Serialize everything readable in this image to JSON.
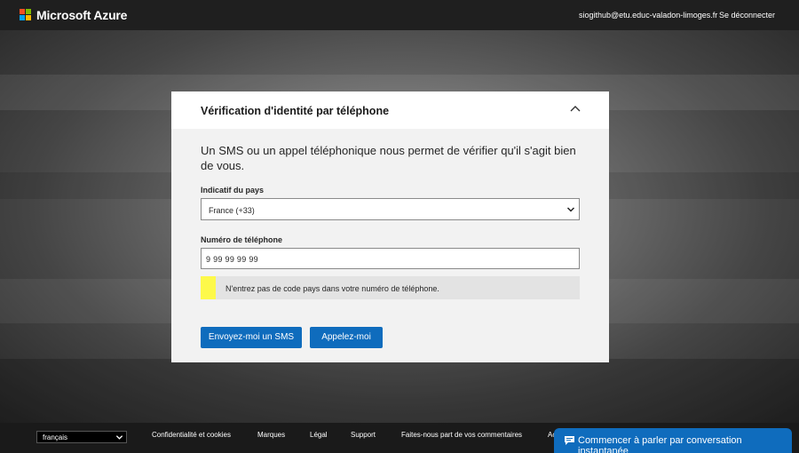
{
  "header": {
    "brand": "Microsoft Azure",
    "user_email": "siogithub@etu.educ-valadon-limoges.fr",
    "signout_label": "Se déconnecter",
    "logo_colors": [
      "#f25022",
      "#7fba00",
      "#00a4ef",
      "#ffb900"
    ]
  },
  "card": {
    "title": "Vérification d'identité par téléphone",
    "description": "Un SMS ou un appel téléphonique nous permet de vérifier qu'il s'agit bien de vous.",
    "country_label": "Indicatif du pays",
    "country_value": "France (+33)",
    "phone_label": "Numéro de téléphone",
    "phone_value": "9 99 99 99 99",
    "notice": "N'entrez pas de code pays dans votre numéro de téléphone.",
    "sms_button": "Envoyez-moi un SMS",
    "call_button": "Appelez-moi",
    "accent_color": "#0f6cbd",
    "notice_color": "#fdf94a"
  },
  "footer": {
    "language": "français",
    "links": [
      "Confidentialité et cookies",
      "Marques",
      "Légal",
      "Support",
      "Faites-nous part de vos commentaires",
      "Ac"
    ],
    "chat_label": "Commencer à parler par conversation instantanée"
  }
}
